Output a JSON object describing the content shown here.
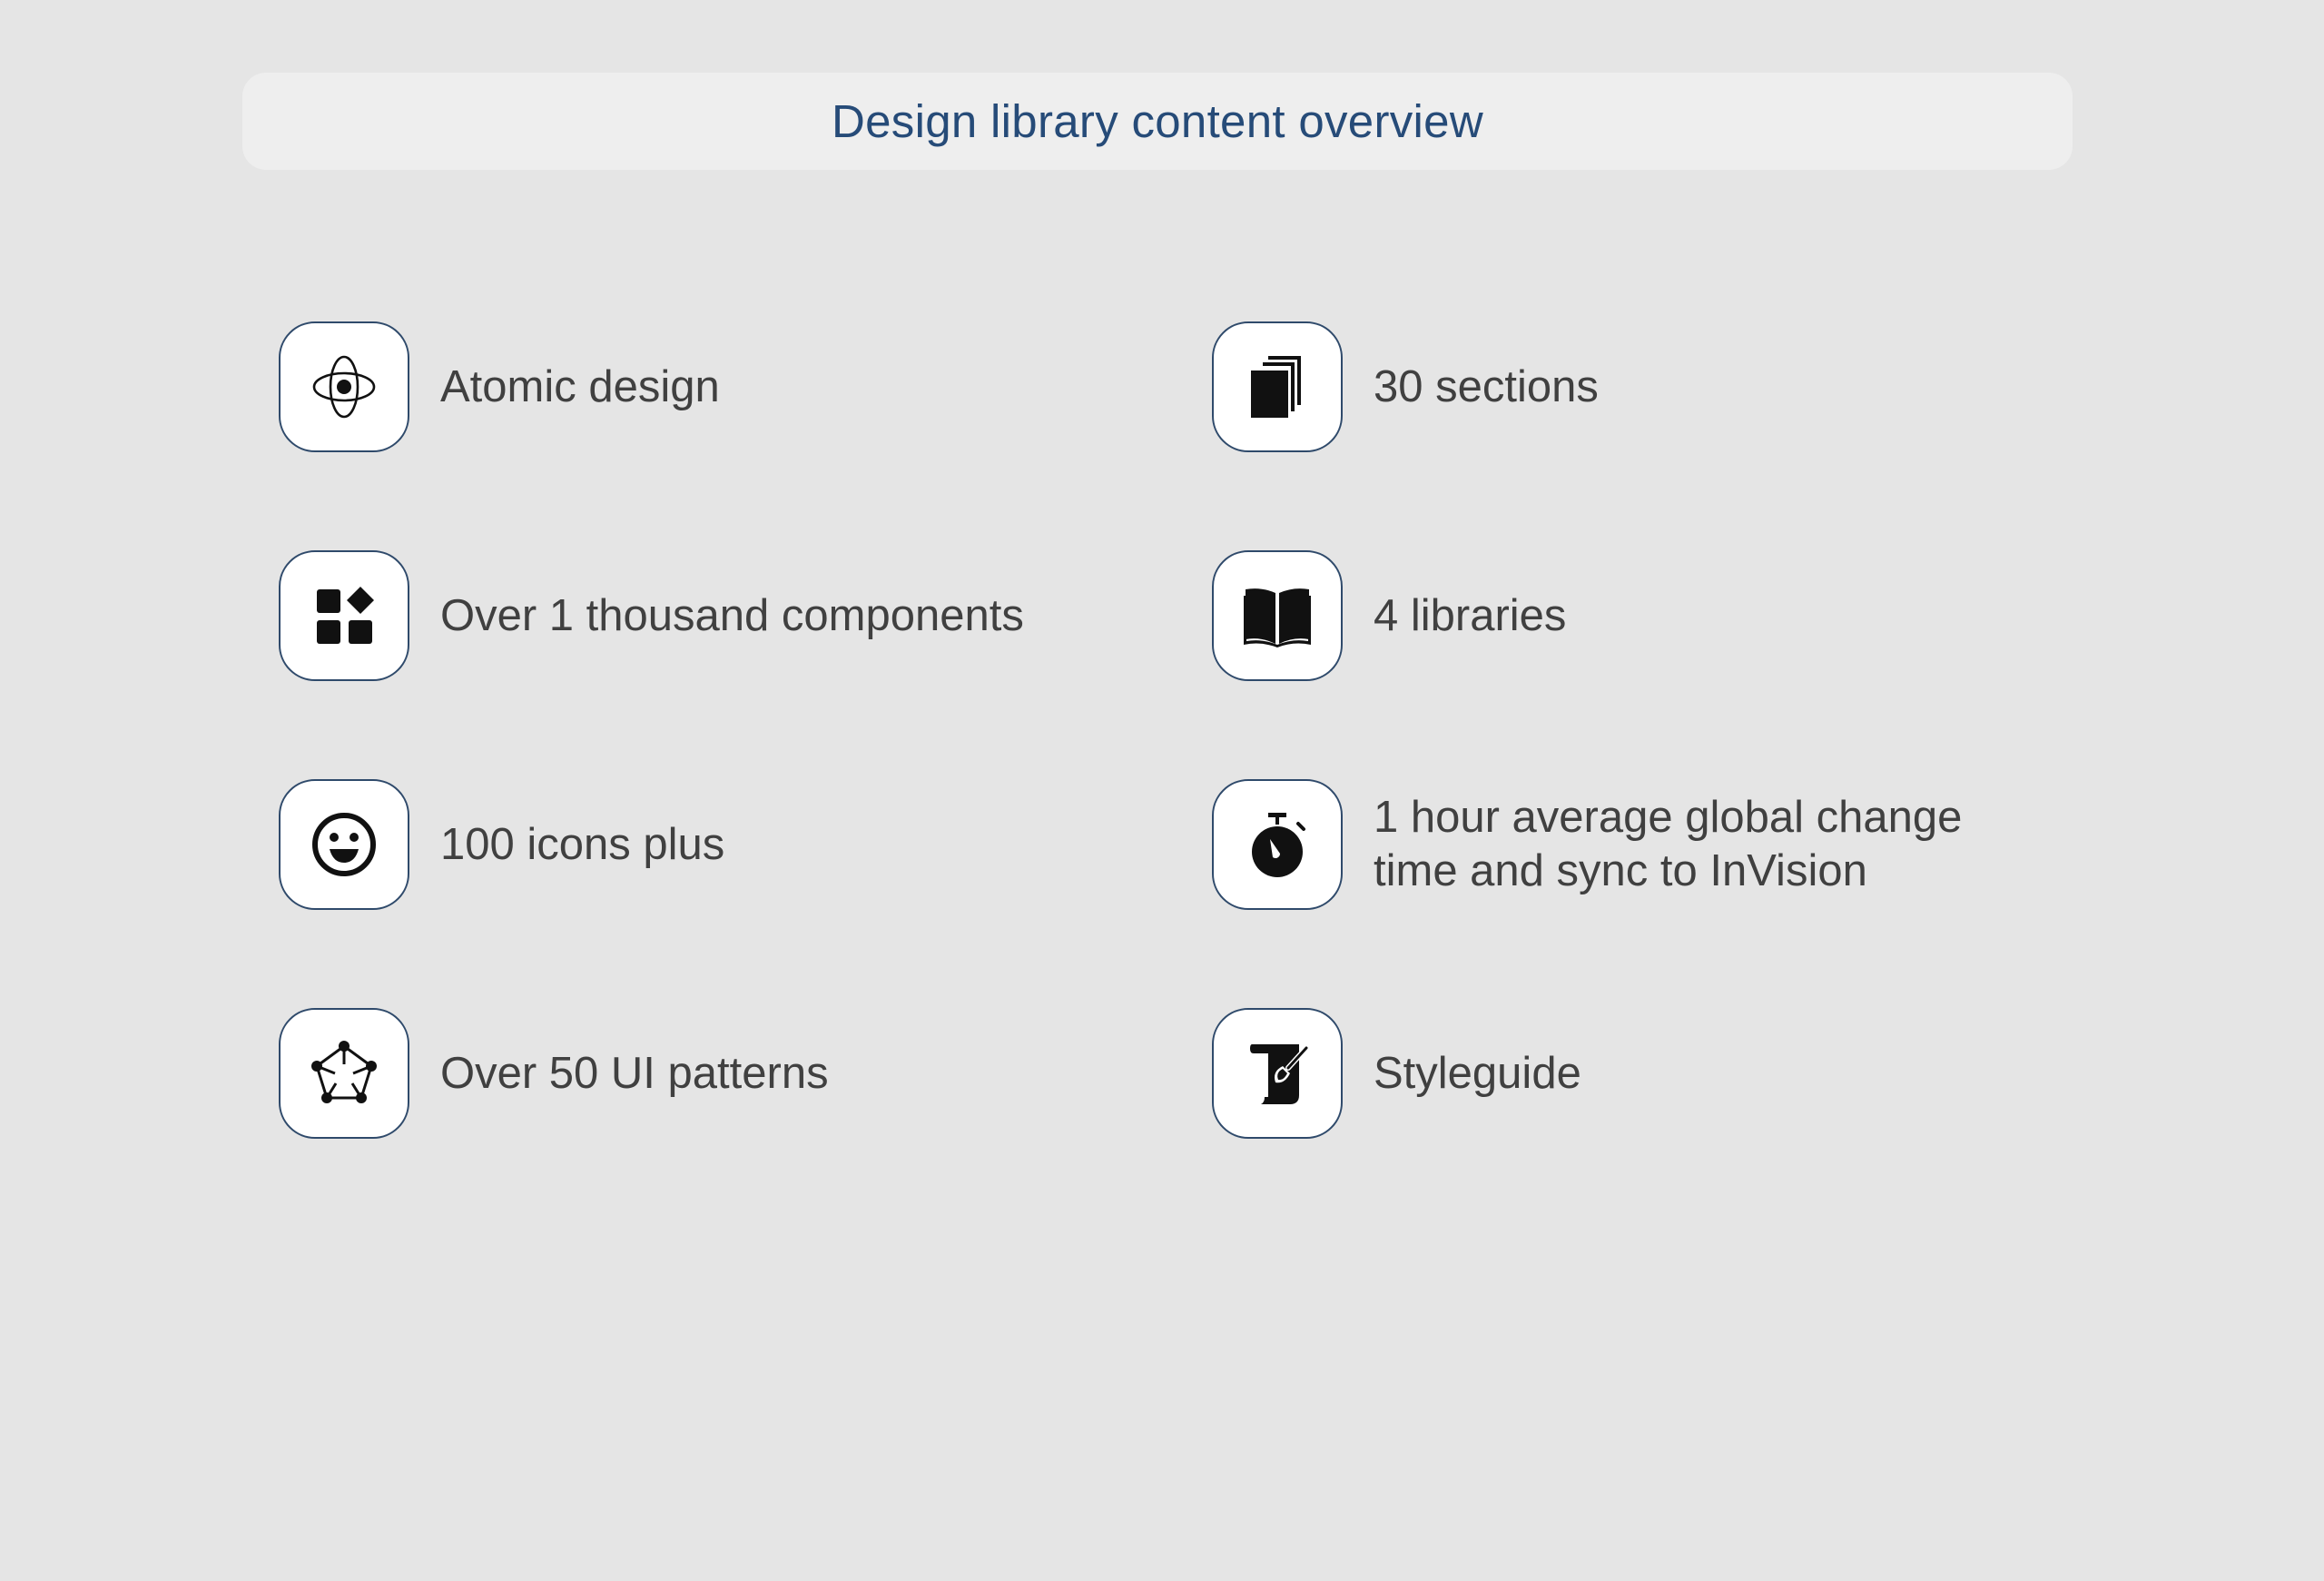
{
  "header": {
    "title": "Design library content overview"
  },
  "items": [
    {
      "icon": "atom-icon",
      "label": "Atomic design"
    },
    {
      "icon": "stacked-pages-icon",
      "label": "30 sections"
    },
    {
      "icon": "components-icon",
      "label": "Over 1 thousand components"
    },
    {
      "icon": "open-book-icon",
      "label": "4 libraries"
    },
    {
      "icon": "smiley-icon",
      "label": "100 icons plus"
    },
    {
      "icon": "stopwatch-icon",
      "label": "1 hour average global  change\ntime and sync to InVision"
    },
    {
      "icon": "pattern-network-icon",
      "label": "Over 50 UI patterns"
    },
    {
      "icon": "scroll-pen-icon",
      "label": "Styleguide"
    }
  ],
  "colors": {
    "background": "#e5e5e5",
    "header_bg": "#eeeeee",
    "title": "#264b78",
    "icon_border": "#2f4a6b",
    "label": "#404040",
    "icon_fill": "#111111"
  }
}
